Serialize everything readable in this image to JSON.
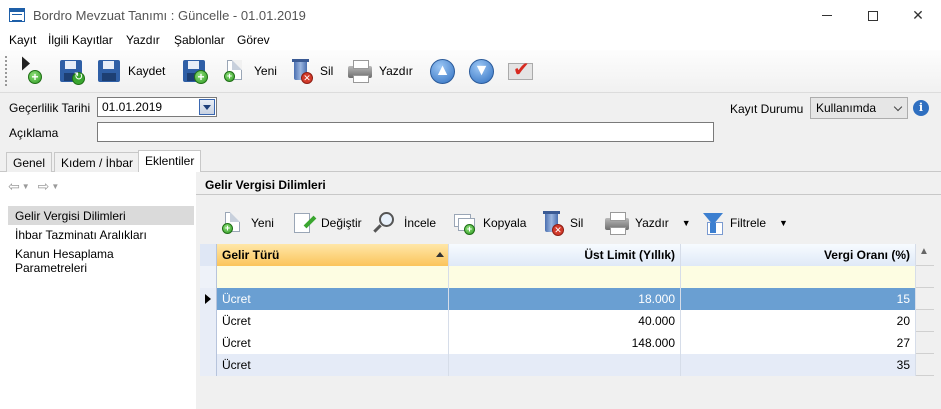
{
  "window": {
    "title": "Bordro Mevzuat Tanımı : Güncelle - 01.01.2019"
  },
  "menu": [
    "Kayıt",
    "İlgili Kayıtlar",
    "Yazdır",
    "Şablonlar",
    "Görev"
  ],
  "toolbar": {
    "save_label": "Kaydet",
    "new_label": "Yeni",
    "delete_label": "Sil",
    "print_label": "Yazdır"
  },
  "form": {
    "validity_date_label": "Geçerlilik Tarihi",
    "validity_date_value": "01.01.2019",
    "description_label": "Açıklama",
    "description_value": "",
    "record_status_label": "Kayıt Durumu",
    "record_status_value": "Kullanımda"
  },
  "tabs": [
    "Genel",
    "Kıdem / İhbar",
    "Eklentiler"
  ],
  "nav": {
    "items": [
      "Gelir Vergisi Dilimleri",
      "İhbar Tazminatı Aralıkları",
      "Kanun Hesaplama Parametreleri"
    ]
  },
  "panel": {
    "title": "Gelir Vergisi Dilimleri",
    "toolbar": {
      "new_label": "Yeni",
      "edit_label": "Değiştir",
      "inspect_label": "İncele",
      "copy_label": "Kopyala",
      "delete_label": "Sil",
      "print_label": "Yazdır",
      "filter_label": "Filtrele"
    }
  },
  "grid": {
    "columns": [
      "Gelir Türü",
      "Üst Limit (Yıllık)",
      "Vergi Oranı (%)"
    ],
    "rows": [
      {
        "type": "Ücret",
        "limit": "18.000",
        "rate": "15"
      },
      {
        "type": "Ücret",
        "limit": "40.000",
        "rate": "20"
      },
      {
        "type": "Ücret",
        "limit": "148.000",
        "rate": "27"
      },
      {
        "type": "Ücret",
        "limit": "",
        "rate": "35"
      }
    ]
  },
  "colors": {
    "selected_row": "#6a9fd2",
    "header_sorted": "#fbc45b",
    "alt_row": "#e5ebf7",
    "filter_row": "#fdfde2"
  }
}
